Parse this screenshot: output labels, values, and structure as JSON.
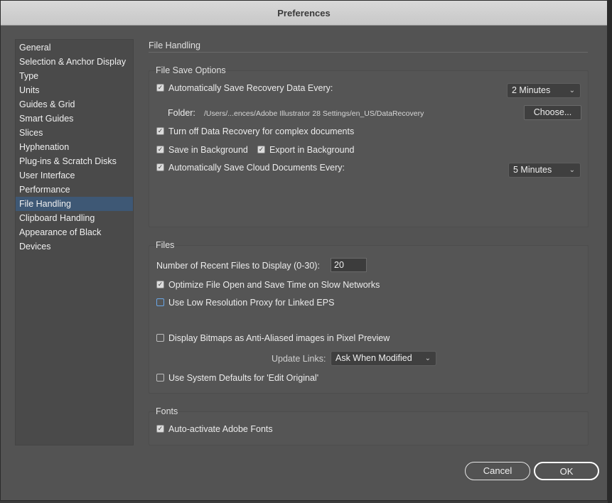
{
  "window": {
    "title": "Preferences"
  },
  "sidebar": {
    "items": [
      {
        "label": "General"
      },
      {
        "label": "Selection & Anchor Display"
      },
      {
        "label": "Type"
      },
      {
        "label": "Units"
      },
      {
        "label": "Guides & Grid"
      },
      {
        "label": "Smart Guides"
      },
      {
        "label": "Slices"
      },
      {
        "label": "Hyphenation"
      },
      {
        "label": "Plug-ins & Scratch Disks"
      },
      {
        "label": "User Interface"
      },
      {
        "label": "Performance"
      },
      {
        "label": "File Handling",
        "selected": true
      },
      {
        "label": "Clipboard Handling"
      },
      {
        "label": "Appearance of Black"
      },
      {
        "label": "Devices"
      }
    ]
  },
  "main": {
    "heading": "File Handling",
    "save_options": {
      "title": "File Save Options",
      "auto_save": {
        "label": "Automatically Save Recovery Data Every:",
        "checked": true,
        "interval": "2 Minutes"
      },
      "folder": {
        "label": "Folder:",
        "path": "/Users/...ences/Adobe Illustrator 28 Settings/en_US/DataRecovery",
        "choose_label": "Choose..."
      },
      "turn_off_recovery": {
        "label": "Turn off Data Recovery for complex documents",
        "checked": true
      },
      "save_background": {
        "label": "Save in Background",
        "checked": true
      },
      "export_background": {
        "label": "Export in Background",
        "checked": true
      },
      "cloud_save": {
        "label": "Automatically Save Cloud Documents Every:",
        "checked": true,
        "interval": "5 Minutes"
      }
    },
    "files": {
      "title": "Files",
      "recent_files_label": "Number of Recent Files to Display (0-30):",
      "recent_files_value": "20",
      "optimize": {
        "label": "Optimize File Open and Save Time on Slow Networks",
        "checked": true
      },
      "low_res_proxy": {
        "label": "Use Low Resolution Proxy for Linked EPS",
        "checked": false
      },
      "anti_aliased": {
        "label": "Display Bitmaps as Anti-Aliased images in Pixel Preview",
        "checked": false
      },
      "update_links_label": "Update Links:",
      "update_links_value": "Ask When Modified",
      "system_defaults": {
        "label": "Use System Defaults for 'Edit Original'",
        "checked": false
      }
    },
    "fonts": {
      "title": "Fonts",
      "auto_activate": {
        "label": "Auto-activate Adobe Fonts",
        "checked": true
      }
    }
  },
  "footer": {
    "cancel_label": "Cancel",
    "ok_label": "OK"
  },
  "icons": {
    "check": "check-icon",
    "chevron": "chevron-down-icon"
  }
}
